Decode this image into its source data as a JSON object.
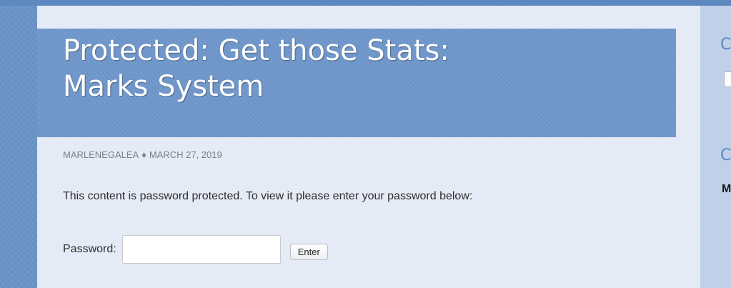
{
  "post": {
    "title_line1": "Protected: Get those Stats:",
    "title_line2": "Marks System",
    "author": "MARLENEGALEA",
    "separator": "♦",
    "date": "MARCH 27, 2019",
    "message": "This content is password protected. To view it please enter your password below:"
  },
  "password_form": {
    "label": "Password:",
    "value": "",
    "submit_label": "Enter"
  },
  "sidebar": {
    "heading1_fragment": "C",
    "heading2_fragment": "C",
    "bold_fragment": "M"
  },
  "colors": {
    "background": "#6a93c8",
    "content_panel": "#e3e9f5",
    "title_banner": "#6e95c9",
    "title_text": "#ffffff",
    "meta_text": "#7c7f86",
    "sidebar_heading": "#5a87c4"
  }
}
